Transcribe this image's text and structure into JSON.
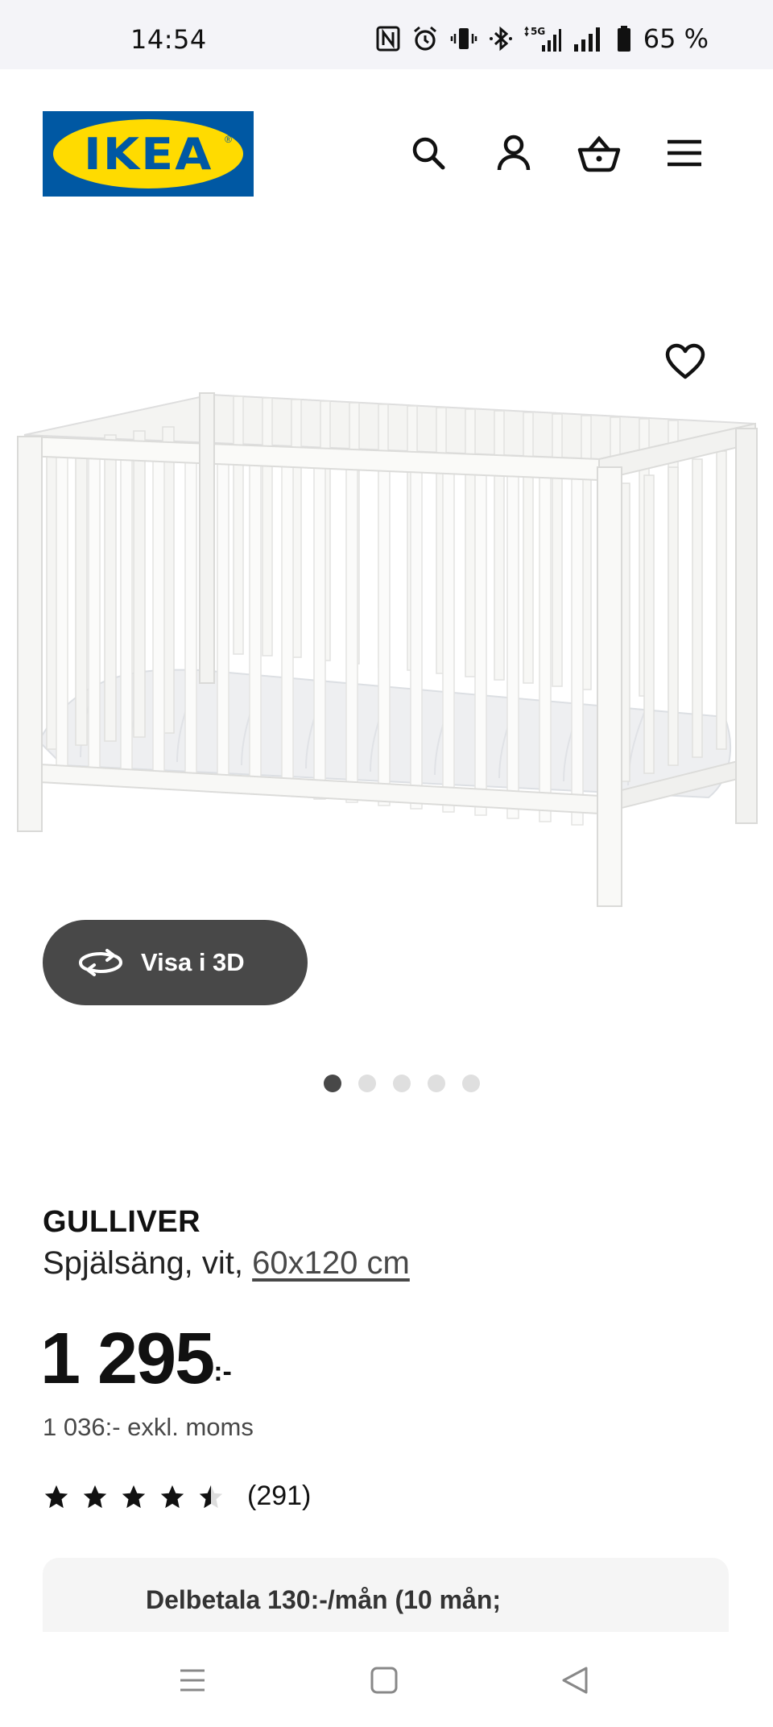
{
  "status_bar": {
    "time": "14:54",
    "battery": "65 %",
    "icons": [
      "nfc-icon",
      "alarm-icon",
      "vibrate-icon",
      "bluetooth-icon",
      "signal-5g-icon",
      "signal-icon",
      "battery-icon"
    ]
  },
  "header": {
    "logo_text": "IKEA",
    "icons": [
      "search-icon",
      "account-icon",
      "cart-icon",
      "menu-icon"
    ]
  },
  "gallery": {
    "view_3d_label": "Visa i 3D",
    "dot_count": 5,
    "active_index": 0
  },
  "product": {
    "name": "GULLIVER",
    "desc_prefix": "Spjälsäng, vit, ",
    "size": "60x120 cm",
    "price": "1 295",
    "price_suffix": ":-",
    "price_ex_vat": "1 036:- exkl. moms",
    "rating": 4.5,
    "review_count": "(291)"
  },
  "payment": {
    "text": "Delbetala 130:-/mån (10 mån;"
  },
  "colors": {
    "brand_blue": "#0058a3",
    "brand_yellow": "#ffdb00",
    "dark_button": "#484848"
  }
}
